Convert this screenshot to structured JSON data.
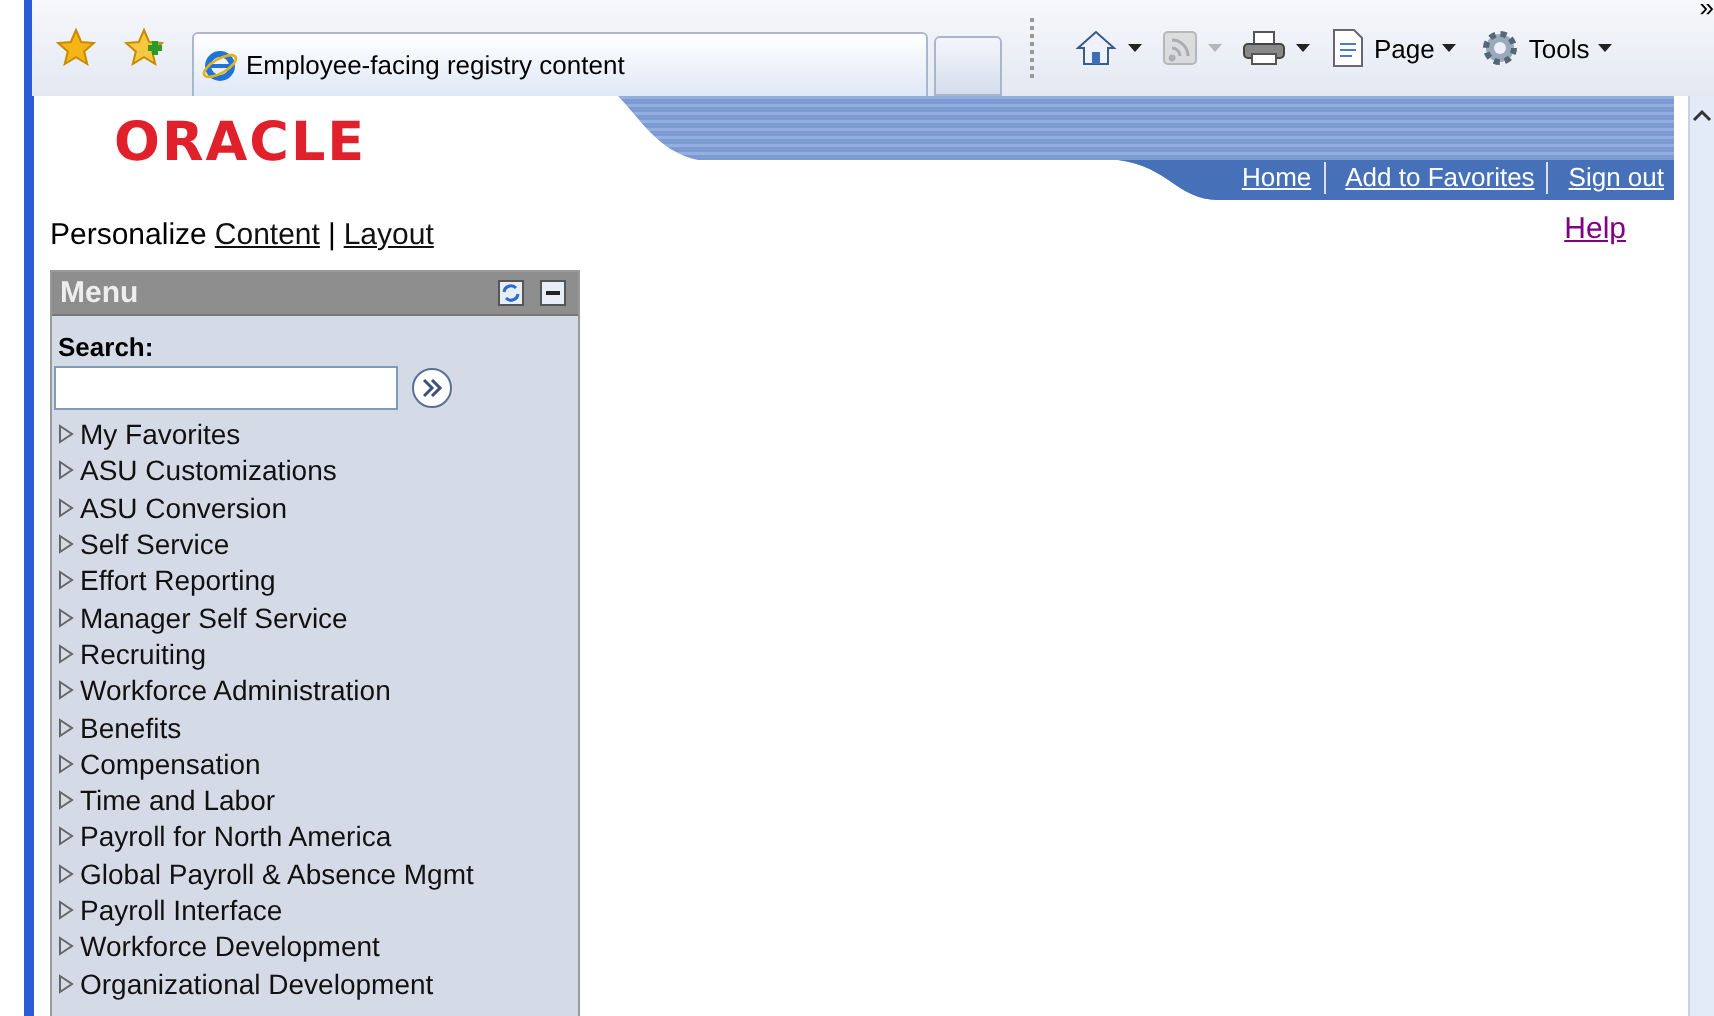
{
  "browser": {
    "tab_title": "Employee-facing registry content",
    "page_label": "Page",
    "tools_label": "Tools",
    "overflow": "»"
  },
  "header": {
    "logo": "ORACLE",
    "links": [
      "Home",
      "Add to Favorites",
      "Sign out"
    ],
    "help": "Help"
  },
  "personalize": {
    "label": "Personalize",
    "links": [
      "Content",
      "Layout"
    ],
    "separator": "|"
  },
  "menu": {
    "title": "Menu",
    "search_label": "Search:",
    "items": [
      {
        "label": "My Favorites",
        "expanded": false
      },
      {
        "label": "ASU Customizations",
        "expanded": false
      },
      {
        "label": "ASU Conversion",
        "expanded": false
      },
      {
        "label": "Self Service",
        "expanded": false
      },
      {
        "label": "Effort Reporting",
        "expanded": false
      },
      {
        "label": "Manager Self Service",
        "expanded": false
      },
      {
        "label": "Recruiting",
        "expanded": false
      },
      {
        "label": "Workforce Administration",
        "expanded": false
      },
      {
        "label": "Benefits",
        "expanded": false
      },
      {
        "label": "Compensation",
        "expanded": false
      },
      {
        "label": "Time and Labor",
        "expanded": false
      },
      {
        "label": "Payroll for North America",
        "expanded": false
      },
      {
        "label": "Global Payroll & Absence Mgmt",
        "expanded": false
      },
      {
        "label": "Payroll Interface",
        "expanded": false
      },
      {
        "label": "Workforce Development",
        "expanded": false
      },
      {
        "label": "Organizational Development",
        "expanded": false
      }
    ]
  }
}
